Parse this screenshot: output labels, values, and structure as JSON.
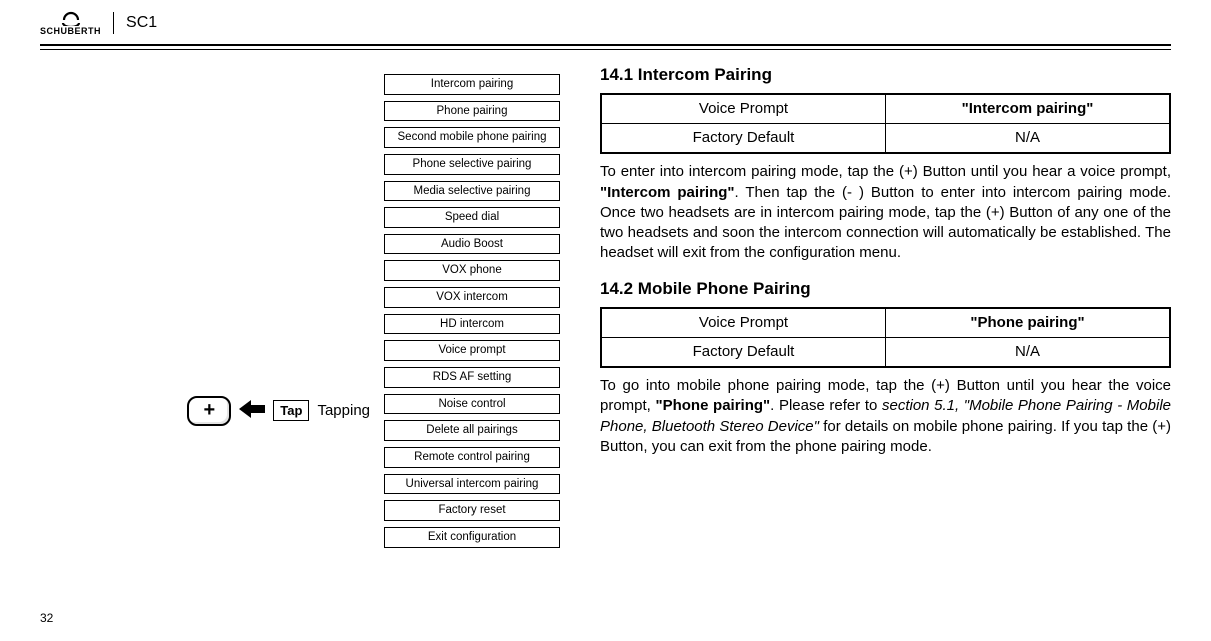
{
  "header": {
    "brand": "SCHUBERTH",
    "model": "SC1"
  },
  "left": {
    "plus_symbol": "+",
    "tap_box": "Tap",
    "tap_label": "Tapping",
    "menu_items": [
      "Intercom pairing",
      "Phone pairing",
      "Second mobile phone pairing",
      "Phone selective pairing",
      "Media selective pairing",
      "Speed dial",
      "Audio Boost",
      "VOX phone",
      "VOX intercom",
      "HD intercom",
      "Voice prompt",
      "RDS AF setting",
      "Noise control",
      "Delete all pairings",
      "Remote control pairing",
      "Universal intercom pairing",
      "Factory reset",
      "Exit configuration"
    ]
  },
  "right": {
    "sec1_title": "14.1 Intercom Pairing",
    "sec1_table": {
      "r1c1": "Voice Prompt",
      "r1c2": "\"Intercom pairing\"",
      "r2c1": "Factory Default",
      "r2c2": "N/A"
    },
    "sec1_para_a": "To enter into intercom pairing mode, tap the (+) Button until you hear a voice prompt, ",
    "sec1_para_b": "\"Intercom pairing\"",
    "sec1_para_c": ". Then tap the (- ) Button to enter into intercom pairing mode. Once two headsets are in intercom pairing mode, tap the (+) Button of any one of the two headsets and soon the intercom connection will automatically be established. The headset will exit from the configuration menu.",
    "sec2_title": "14.2 Mobile Phone Pairing",
    "sec2_table": {
      "r1c1": "Voice Prompt",
      "r1c2": "\"Phone pairing\"",
      "r2c1": "Factory Default",
      "r2c2": "N/A"
    },
    "sec2_para_a": "To go into mobile phone pairing mode, tap the (+) Button until you hear the voice prompt, ",
    "sec2_para_b": "\"Phone pairing\"",
    "sec2_para_c": ". Please refer to ",
    "sec2_para_d": "section 5.1, \"Mobile Phone Pairing - Mobile Phone, Bluetooth Stereo Device\"",
    "sec2_para_e": " for details on mobile phone pairing. If you tap the (+) Button, you can exit from the phone pairing mode."
  },
  "page_number": "32"
}
